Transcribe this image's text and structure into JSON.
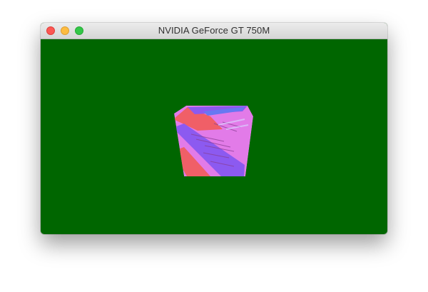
{
  "window": {
    "title": "NVIDIA GeForce GT 750M",
    "clear_color": "#006600"
  },
  "traffic_lights": {
    "close": "close-icon",
    "minimize": "minimize-icon",
    "zoom": "zoom-icon"
  },
  "cube": {
    "colors": {
      "pink": "#e27be8",
      "violet": "#8c5af0",
      "red": "#f05f67",
      "blue": "#6878f2"
    }
  }
}
